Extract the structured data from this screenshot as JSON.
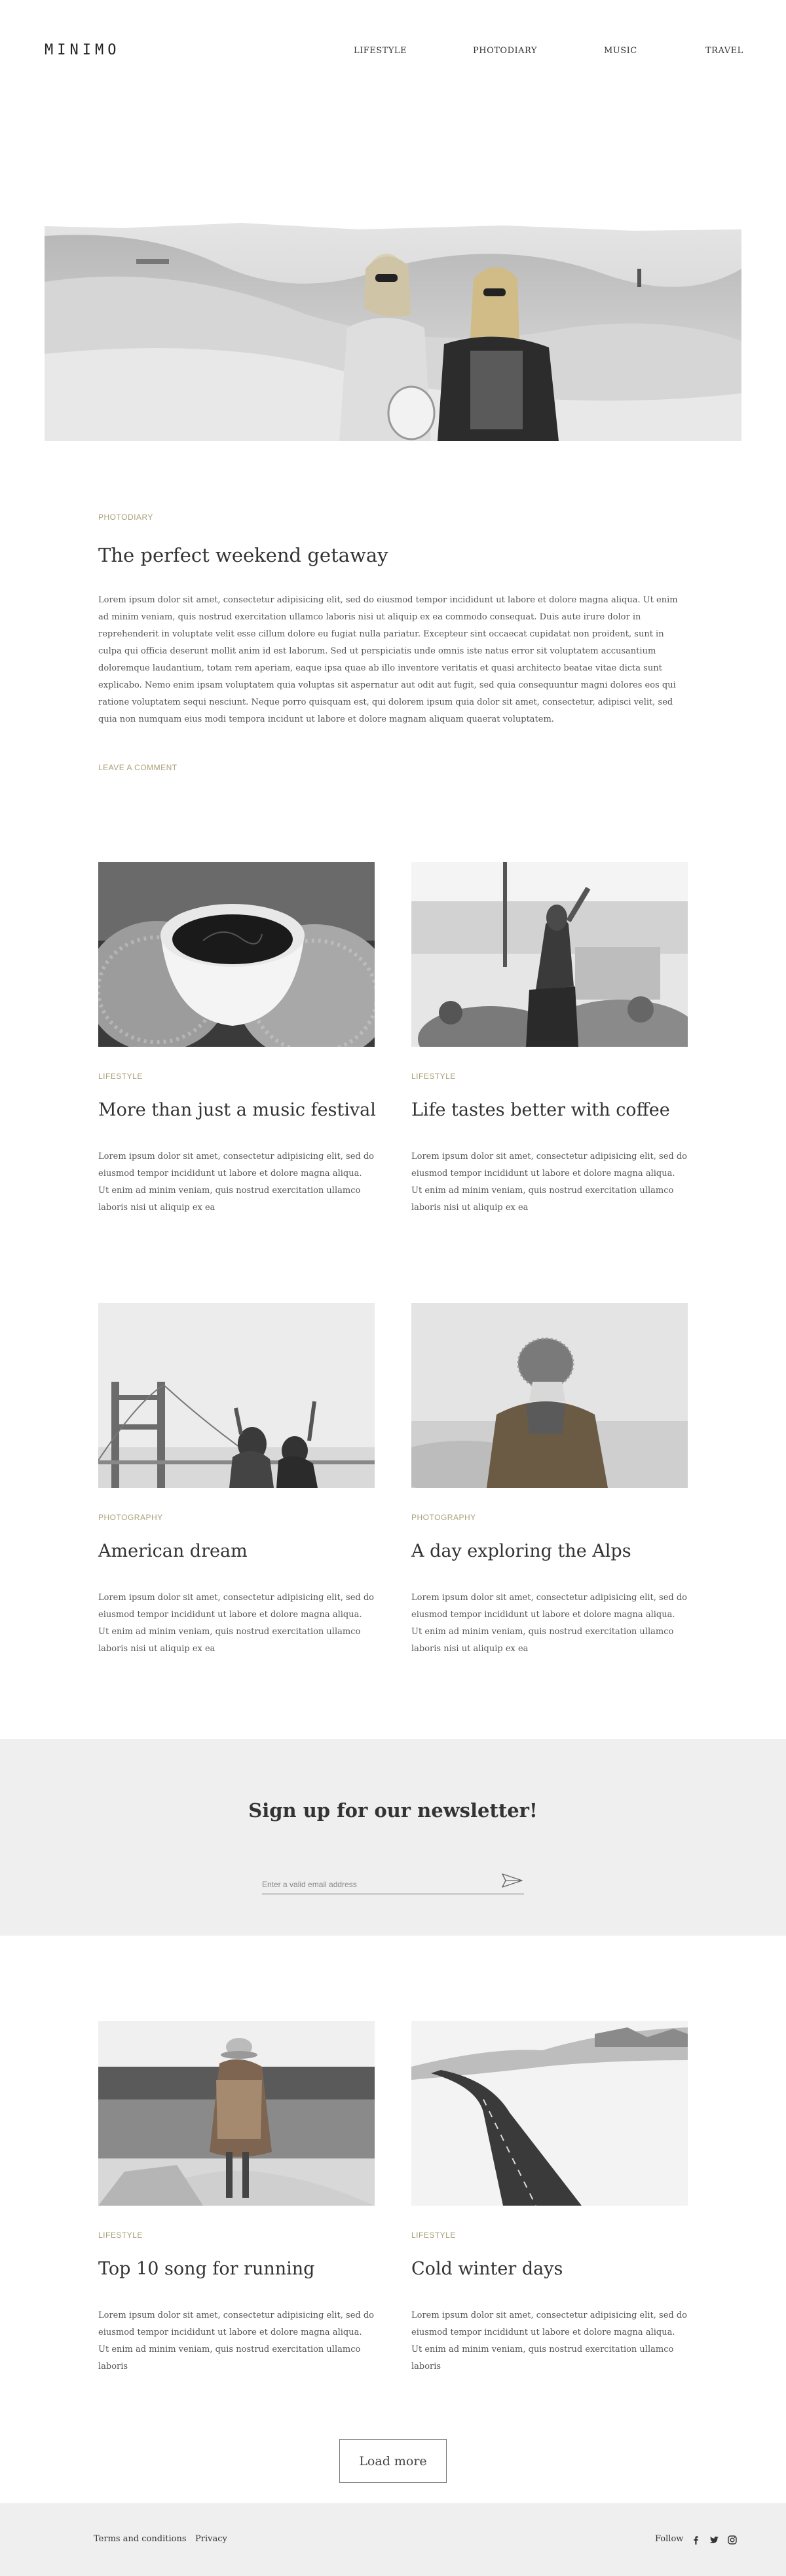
{
  "header": {
    "logo": "MINIMO",
    "nav": [
      "LIFESTYLE",
      "PHOTODIARY",
      "MUSIC",
      "TRAVEL"
    ]
  },
  "featured": {
    "category": "PHOTODIARY",
    "title": "The perfect weekend getaway",
    "excerpt": "Lorem ipsum dolor sit amet, consectetur adipisicing elit, sed do eiusmod tempor incididunt ut labore et dolore magna aliqua. Ut enim ad minim veniam, quis nostrud exercitation ullamco laboris nisi ut aliquip ex ea commodo consequat. Duis aute irure dolor in reprehenderit in voluptate velit esse cillum dolore eu fugiat nulla pariatur. Excepteur sint occaecat cupidatat non proident, sunt in culpa qui officia deserunt mollit anim id est laborum. Sed ut perspiciatis unde omnis iste natus error sit voluptatem accusantium doloremque laudantium, totam rem aperiam, eaque ipsa quae ab illo inventore veritatis et quasi architecto beatae vitae dicta sunt explicabo. Nemo enim ipsam voluptatem quia voluptas sit aspernatur aut odit aut fugit, sed quia consequuntur magni dolores eos qui ratione voluptatem sequi nesciunt. Neque porro quisquam est, qui dolorem ipsum quia dolor sit amet, consectetur, adipisci velit, sed quia non numquam eius modi tempora incidunt ut labore et dolore magnam aliquam quaerat voluptatem.",
    "comment_label": "LEAVE A COMMENT"
  },
  "posts": [
    {
      "category": "LIFESTYLE",
      "title": "More than just a music festival",
      "excerpt": "Lorem ipsum dolor sit amet, consectetur adipisicing elit, sed do eiusmod tempor incididunt ut labore et dolore magna aliqua. Ut enim ad minim veniam, quis nostrud exercitation ullamco laboris nisi ut aliquip ex ea"
    },
    {
      "category": "LIFESTYLE",
      "title": "Life tastes better with coffee",
      "excerpt": "Lorem ipsum dolor sit amet, consectetur adipisicing elit, sed do eiusmod tempor incididunt ut labore et dolore magna aliqua. Ut enim ad minim veniam, quis nostrud exercitation ullamco laboris nisi ut aliquip ex ea"
    },
    {
      "category": "PHOTOGRAPHY",
      "title": "American dream",
      "excerpt": "Lorem ipsum dolor sit amet, consectetur adipisicing elit, sed do eiusmod tempor incididunt ut labore et dolore magna aliqua. Ut enim ad minim veniam, quis nostrud exercitation ullamco laboris nisi ut aliquip ex ea"
    },
    {
      "category": "PHOTOGRAPHY",
      "title": "A day exploring the Alps",
      "excerpt": "Lorem ipsum dolor sit amet, consectetur adipisicing elit, sed do eiusmod tempor incididunt ut labore et dolore magna aliqua. Ut enim ad minim veniam, quis nostrud exercitation ullamco laboris nisi ut aliquip ex ea"
    },
    {
      "category": "LIFESTYLE",
      "title": "Top 10 song for running",
      "excerpt": "Lorem ipsum dolor sit amet, consectetur adipisicing elit, sed do eiusmod tempor incididunt ut labore et dolore magna aliqua. Ut enim ad minim veniam, quis nostrud exercitation ullamco laboris"
    },
    {
      "category": "LIFESTYLE",
      "title": "Cold winter days",
      "excerpt": "Lorem ipsum dolor sit amet, consectetur adipisicing elit, sed do eiusmod tempor incididunt ut labore et dolore magna aliqua. Ut enim ad minim veniam, quis nostrud exercitation ullamco laboris"
    }
  ],
  "newsletter": {
    "title": "Sign up for our newsletter!",
    "placeholder": "Enter a valid email address",
    "send_icon": "paper-plane-icon"
  },
  "load_more": "Load more",
  "footer": {
    "terms": "Terms and conditions",
    "privacy": "Privacy",
    "follow": "Follow",
    "social_icons": [
      "facebook-icon",
      "twitter-icon",
      "instagram-icon"
    ]
  }
}
